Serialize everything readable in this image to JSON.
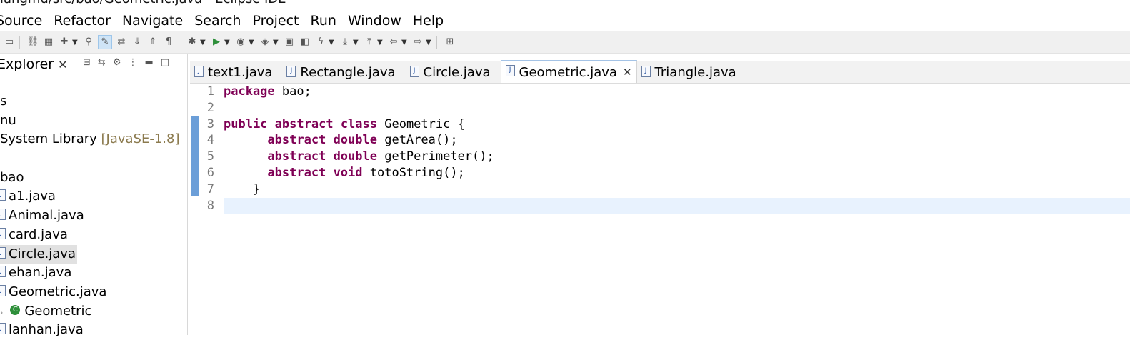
{
  "window": {
    "title": "iangmu/src/bao/Geometric.java - Eclipse IDE"
  },
  "menu": [
    "Source",
    "Refactor",
    "Navigate",
    "Search",
    "Project",
    "Run",
    "Window",
    "Help"
  ],
  "toolbar_icons": [
    "monitor-icon",
    "link-icon",
    "package-icon",
    "new-class-icon",
    "search-icon",
    "highlight-icon",
    "toggle-mark-icon",
    "next-annotation-icon",
    "prev-annotation-icon",
    "pilcrow-icon",
    "debug-icon",
    "run-icon",
    "coverage-icon",
    "external-tools-icon",
    "open-folder-icon",
    "open-type-icon",
    "lightning-icon",
    "next-edit-icon",
    "prev-edit-icon",
    "back-icon",
    "forward-icon",
    "new-window-icon"
  ],
  "left_panel": {
    "tab_label": "Explorer",
    "tree": [
      {
        "text": "s"
      },
      {
        "text": "nu"
      },
      {
        "text": " System Library ",
        "suffix": "[JavaSE-1.8]"
      },
      {
        "text": ""
      },
      {
        "text": "bao"
      },
      {
        "text": "a1.java",
        "icon": "java-file-icon"
      },
      {
        "text": "Animal.java",
        "icon": "java-file-icon"
      },
      {
        "text": "card.java",
        "icon": "java-file-icon"
      },
      {
        "text": "Circle.java",
        "icon": "java-file-icon",
        "selected": true
      },
      {
        "text": "ehan.java",
        "icon": "java-file-icon"
      },
      {
        "text": "Geometric.java",
        "icon": "java-file-icon"
      },
      {
        "text": "Geometric",
        "icon": "class-icon",
        "child": true
      },
      {
        "text": "lanhan.java",
        "icon": "java-file-icon"
      }
    ]
  },
  "editor": {
    "tabs": [
      {
        "label": "text1.java",
        "active": false
      },
      {
        "label": "Rectangle.java",
        "active": false
      },
      {
        "label": "Circle.java",
        "active": false
      },
      {
        "label": "Geometric.java",
        "active": true
      },
      {
        "label": "Triangle.java",
        "active": false
      }
    ],
    "line_numbers": [
      "1",
      "2",
      "3",
      "4",
      "5",
      "6",
      "7",
      "8"
    ],
    "current_line": 8,
    "lines": [
      [
        {
          "t": "package",
          "k": true
        },
        {
          "t": " bao;"
        }
      ],
      [],
      [
        {
          "t": "public",
          "k": true
        },
        {
          "t": " "
        },
        {
          "t": "abstract",
          "k": true
        },
        {
          "t": " "
        },
        {
          "t": "class",
          "k": true
        },
        {
          "t": " Geometric {"
        }
      ],
      [
        {
          "t": "      "
        },
        {
          "t": "abstract",
          "k": true
        },
        {
          "t": " "
        },
        {
          "t": "double",
          "k": true
        },
        {
          "t": " getArea();"
        }
      ],
      [
        {
          "t": "      "
        },
        {
          "t": "abstract",
          "k": true
        },
        {
          "t": " "
        },
        {
          "t": "double",
          "k": true
        },
        {
          "t": " getPerimeter();"
        }
      ],
      [
        {
          "t": "      "
        },
        {
          "t": "abstract",
          "k": true
        },
        {
          "t": " "
        },
        {
          "t": "void",
          "k": true
        },
        {
          "t": " totoString();"
        }
      ],
      [
        {
          "t": "    }"
        }
      ],
      []
    ]
  },
  "colors": {
    "keyword": "#7f0055",
    "current_line": "#e8f2fe",
    "ruler_mark": "#6b9ed8"
  }
}
